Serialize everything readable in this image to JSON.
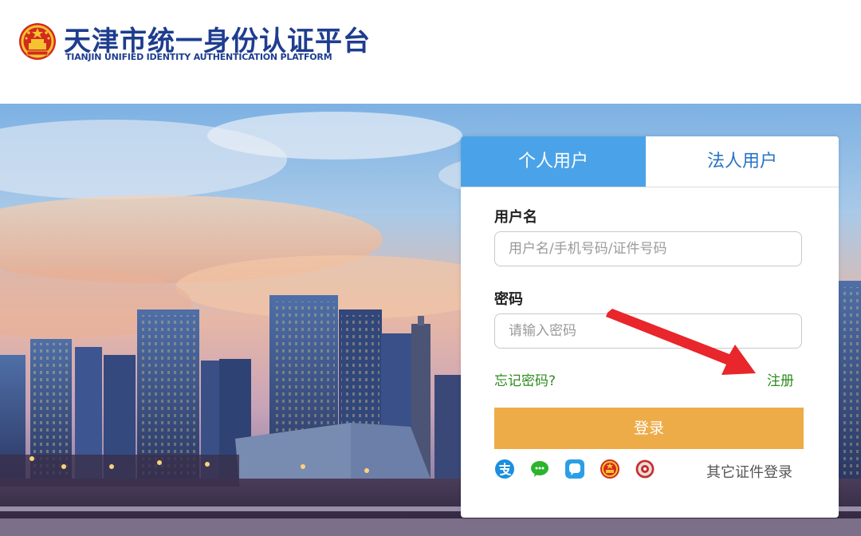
{
  "header": {
    "title_cn": "天津市统一身份认证平台",
    "title_en": "TIANJIN UNIFIED IDENTITY AUTHENTICATION PLATFORM"
  },
  "tabs": [
    {
      "label": "个人用户",
      "active": true
    },
    {
      "label": "法人用户",
      "active": false
    }
  ],
  "form": {
    "username_label": "用户名",
    "username_placeholder": "用户名/手机号码/证件号码",
    "password_label": "密码",
    "password_placeholder": "请输入密码",
    "forgot_label": "忘记密码?",
    "register_label": "注册",
    "login_label": "登录"
  },
  "alt_login": {
    "icons": [
      "alipay-icon",
      "wechat-icon",
      "chat-bubble-icon",
      "national-emblem-icon",
      "seal-icon"
    ],
    "other_label": "其它证件登录"
  },
  "colors": {
    "brand_blue": "#1e3d8f",
    "tab_active": "#4aa3e9",
    "tab_inactive_text": "#2a73c4",
    "link_green": "#2e8b1e",
    "login_button": "#eeac49",
    "annotation_arrow": "#e8262b"
  }
}
